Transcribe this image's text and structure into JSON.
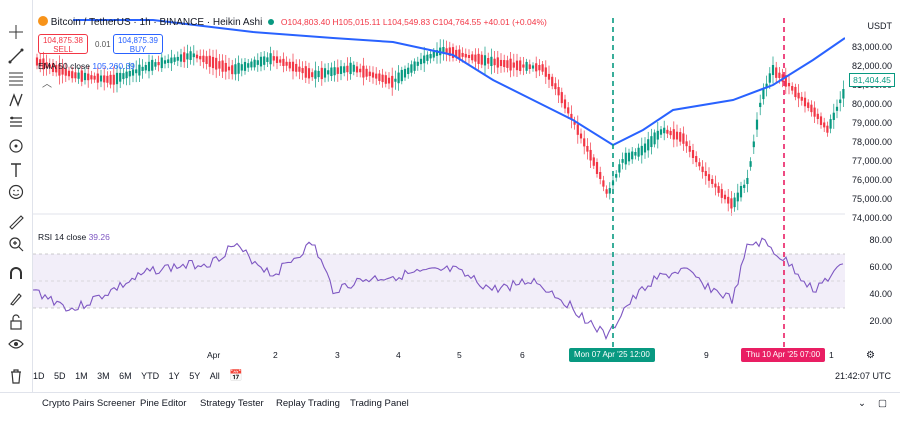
{
  "header": {
    "symbol": "Bitcoin / TetherUS · 1h · BINANCE · Heikin Ashi",
    "ohlc": "O104,803.40 H105,015.11 L104,549.83 C104,764.55 +40.01 (+0.04%)"
  },
  "trade": {
    "sell_price": "104,875.38",
    "sell_label": "SELL",
    "buy_price": "104,875.39",
    "buy_label": "BUY",
    "spread": "0.01"
  },
  "indicators": {
    "ema_label": "EMA 50 close",
    "ema_value": "105,260.39",
    "rsi_label": "RSI 14 close",
    "rsi_value": "39.26"
  },
  "price_axis": {
    "currency": "USDT",
    "ticks": [
      "83,000.00",
      "82,000.00",
      "81,000.00",
      "80,000.00",
      "79,000.00",
      "78,000.00",
      "77,000.00",
      "76,000.00",
      "75,000.00",
      "74,000.00"
    ],
    "current_price": "81,404.45",
    "rsi_ticks": [
      "80.00",
      "60.00",
      "40.00",
      "20.00"
    ]
  },
  "time_axis": {
    "labels": [
      "Apr",
      "2",
      "3",
      "4",
      "5",
      "6",
      "9",
      "1"
    ],
    "badge_left": "Mon 07 Apr '25   12:00",
    "badge_right": "Thu 10 Apr '25   07:00"
  },
  "range_buttons": [
    "1D",
    "5D",
    "1M",
    "3M",
    "6M",
    "YTD",
    "1Y",
    "5Y",
    "All"
  ],
  "clock": "21:42:07 UTC",
  "bottom_tabs": [
    "Crypto Pairs Screener",
    "Pine Editor",
    "Strategy Tester",
    "Replay Trading",
    "Trading Panel"
  ],
  "colors": {
    "up": "#089981",
    "down": "#f23645",
    "ema": "#2962ff",
    "rsi": "#7e57c2",
    "marker_left": "#089981",
    "marker_right": "#e91e63"
  },
  "left_tools": [
    "crosshair-icon",
    "trend-line-icon",
    "fib-icon",
    "pattern-icon",
    "prediction-icon",
    "brush-icon",
    "text-icon",
    "emoji-icon",
    "ruler-icon",
    "zoom-icon",
    "magnet-icon",
    "lock-draw-icon",
    "lock-icon",
    "eye-icon",
    "trash-icon"
  ]
}
